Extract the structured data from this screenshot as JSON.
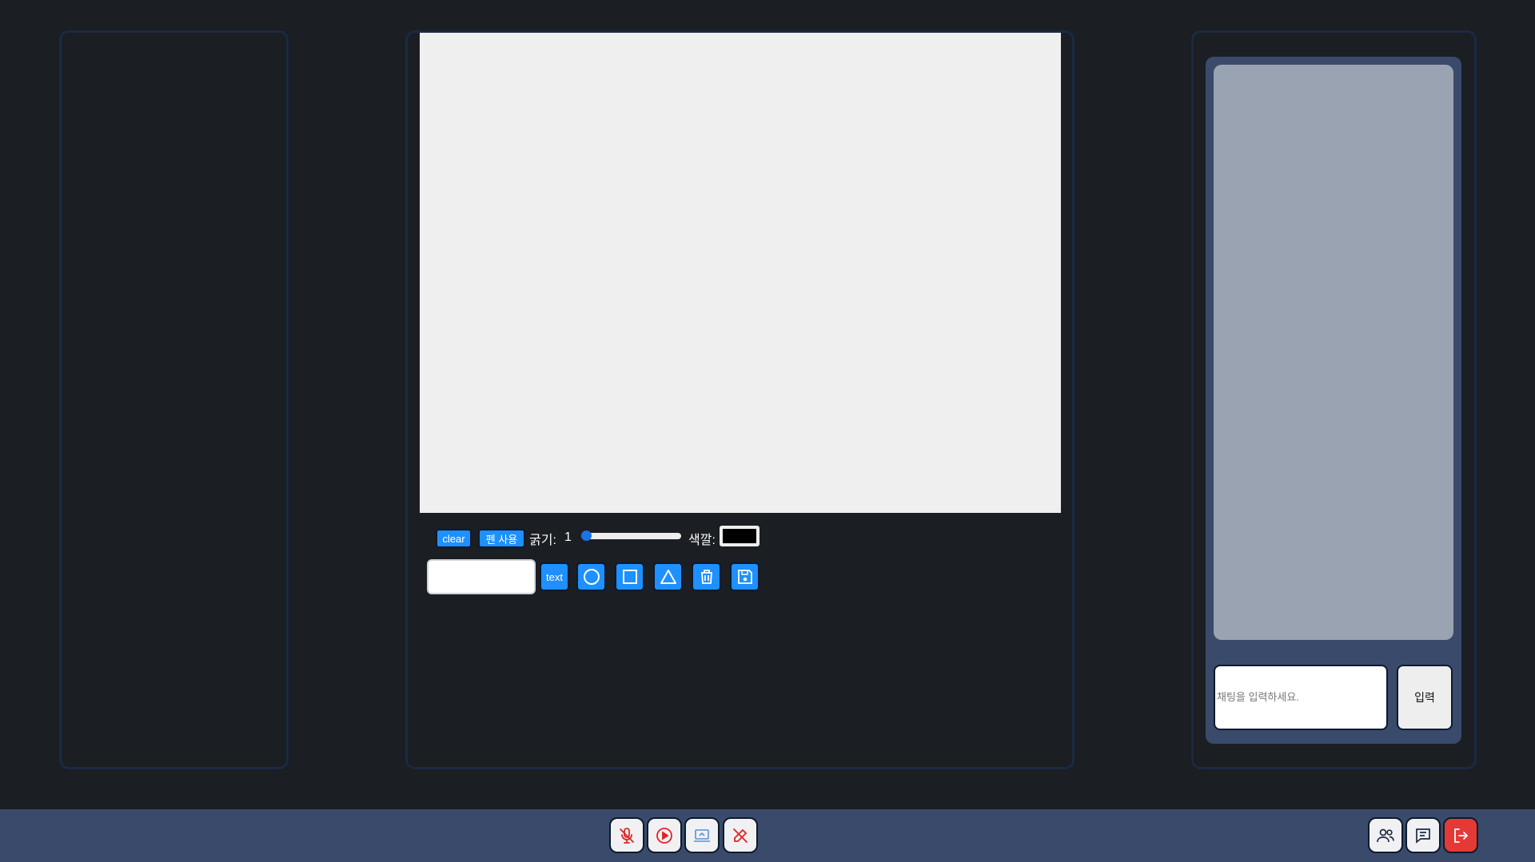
{
  "toolbar": {
    "clear_label": "clear",
    "pen_label": "펜 사용",
    "thickness_label": "굵기:",
    "thickness_value": "1",
    "thickness_level": 1,
    "color_label": "색깔:",
    "color_value": "#000000",
    "text_button_label": "text"
  },
  "tools": [
    "circle-icon",
    "square-icon",
    "triangle-icon",
    "trash-icon",
    "save-icon"
  ],
  "chat": {
    "input_placeholder": "채팅을 입력하세요.",
    "send_label": "입력"
  },
  "bottom_bar": {
    "media_buttons": [
      "mic-off-icon",
      "play-circle-icon",
      "screen-share-icon",
      "pen-off-icon"
    ],
    "right_buttons": [
      "people-icon",
      "chat-icon",
      "exit-icon"
    ]
  },
  "colors": {
    "background": "#1b1e22",
    "accent": "#1e90ff",
    "bar": "#3a4a6a",
    "danger": "#e53935"
  }
}
